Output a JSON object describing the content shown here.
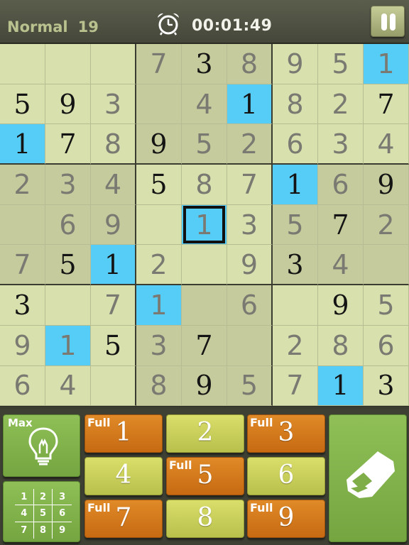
{
  "header": {
    "difficulty": "Normal",
    "level": "19",
    "timer": "00:01:49",
    "clock_icon": "alarm-clock-icon",
    "pause_icon": "pause-icon"
  },
  "board": {
    "selected": [
      4,
      4
    ],
    "highlight_digit": "1",
    "rows": [
      [
        {
          "v": "",
          "t": ""
        },
        {
          "v": "",
          "t": ""
        },
        {
          "v": "",
          "t": ""
        },
        {
          "v": "7",
          "t": "user"
        },
        {
          "v": "3",
          "t": "given"
        },
        {
          "v": "8",
          "t": "user"
        },
        {
          "v": "9",
          "t": "user"
        },
        {
          "v": "5",
          "t": "user"
        },
        {
          "v": "1",
          "t": "user"
        }
      ],
      [
        {
          "v": "5",
          "t": "given"
        },
        {
          "v": "9",
          "t": "given"
        },
        {
          "v": "3",
          "t": "user"
        },
        {
          "v": "",
          "t": ""
        },
        {
          "v": "4",
          "t": "user"
        },
        {
          "v": "1",
          "t": "given"
        },
        {
          "v": "8",
          "t": "user"
        },
        {
          "v": "2",
          "t": "user"
        },
        {
          "v": "7",
          "t": "given"
        }
      ],
      [
        {
          "v": "1",
          "t": "given"
        },
        {
          "v": "7",
          "t": "given"
        },
        {
          "v": "8",
          "t": "user"
        },
        {
          "v": "9",
          "t": "given"
        },
        {
          "v": "5",
          "t": "user"
        },
        {
          "v": "2",
          "t": "user"
        },
        {
          "v": "6",
          "t": "user"
        },
        {
          "v": "3",
          "t": "user"
        },
        {
          "v": "4",
          "t": "user"
        }
      ],
      [
        {
          "v": "2",
          "t": "user"
        },
        {
          "v": "3",
          "t": "user"
        },
        {
          "v": "4",
          "t": "user"
        },
        {
          "v": "5",
          "t": "given"
        },
        {
          "v": "8",
          "t": "user"
        },
        {
          "v": "7",
          "t": "user"
        },
        {
          "v": "1",
          "t": "given"
        },
        {
          "v": "6",
          "t": "user"
        },
        {
          "v": "9",
          "t": "given"
        }
      ],
      [
        {
          "v": "",
          "t": ""
        },
        {
          "v": "6",
          "t": "user"
        },
        {
          "v": "9",
          "t": "user"
        },
        {
          "v": "",
          "t": ""
        },
        {
          "v": "1",
          "t": "user"
        },
        {
          "v": "3",
          "t": "user"
        },
        {
          "v": "5",
          "t": "user"
        },
        {
          "v": "7",
          "t": "given"
        },
        {
          "v": "2",
          "t": "user"
        }
      ],
      [
        {
          "v": "7",
          "t": "user"
        },
        {
          "v": "5",
          "t": "given"
        },
        {
          "v": "1",
          "t": "given"
        },
        {
          "v": "2",
          "t": "user"
        },
        {
          "v": "",
          "t": ""
        },
        {
          "v": "9",
          "t": "user"
        },
        {
          "v": "3",
          "t": "given"
        },
        {
          "v": "4",
          "t": "user"
        },
        {
          "v": "",
          "t": ""
        }
      ],
      [
        {
          "v": "3",
          "t": "given"
        },
        {
          "v": "",
          "t": ""
        },
        {
          "v": "7",
          "t": "user"
        },
        {
          "v": "1",
          "t": "user"
        },
        {
          "v": "",
          "t": ""
        },
        {
          "v": "6",
          "t": "user"
        },
        {
          "v": "",
          "t": ""
        },
        {
          "v": "9",
          "t": "given"
        },
        {
          "v": "5",
          "t": "user"
        }
      ],
      [
        {
          "v": "9",
          "t": "user"
        },
        {
          "v": "1",
          "t": "user"
        },
        {
          "v": "5",
          "t": "given"
        },
        {
          "v": "3",
          "t": "user"
        },
        {
          "v": "7",
          "t": "given"
        },
        {
          "v": "",
          "t": ""
        },
        {
          "v": "2",
          "t": "user"
        },
        {
          "v": "8",
          "t": "user"
        },
        {
          "v": "6",
          "t": "user"
        }
      ],
      [
        {
          "v": "6",
          "t": "user"
        },
        {
          "v": "4",
          "t": "user"
        },
        {
          "v": "",
          "t": ""
        },
        {
          "v": "8",
          "t": "user"
        },
        {
          "v": "9",
          "t": "given"
        },
        {
          "v": "5",
          "t": "user"
        },
        {
          "v": "7",
          "t": "user"
        },
        {
          "v": "1",
          "t": "given"
        },
        {
          "v": "3",
          "t": "given"
        }
      ]
    ]
  },
  "controls": {
    "hint": {
      "label": "Max",
      "icon": "lightbulb-icon"
    },
    "notes": {
      "icon": "number-grid-icon",
      "digits": [
        "1",
        "2",
        "3",
        "4",
        "5",
        "6",
        "7",
        "8",
        "9"
      ]
    },
    "erase": {
      "icon": "eraser-icon"
    },
    "full_label": "Full",
    "numbers": [
      {
        "digit": "1",
        "full": true
      },
      {
        "digit": "2",
        "full": false
      },
      {
        "digit": "3",
        "full": true
      },
      {
        "digit": "4",
        "full": false
      },
      {
        "digit": "5",
        "full": true
      },
      {
        "digit": "6",
        "full": false
      },
      {
        "digit": "7",
        "full": true
      },
      {
        "digit": "8",
        "full": false
      },
      {
        "digit": "9",
        "full": true
      }
    ]
  },
  "colors": {
    "highlight": "#56cdf6",
    "cell_light": "#d8e0ad",
    "cell_shade": "#c5cb9c",
    "full_button": "#d77a1d",
    "number_button": "#cdd25c",
    "tool_button": "#82b24b"
  }
}
